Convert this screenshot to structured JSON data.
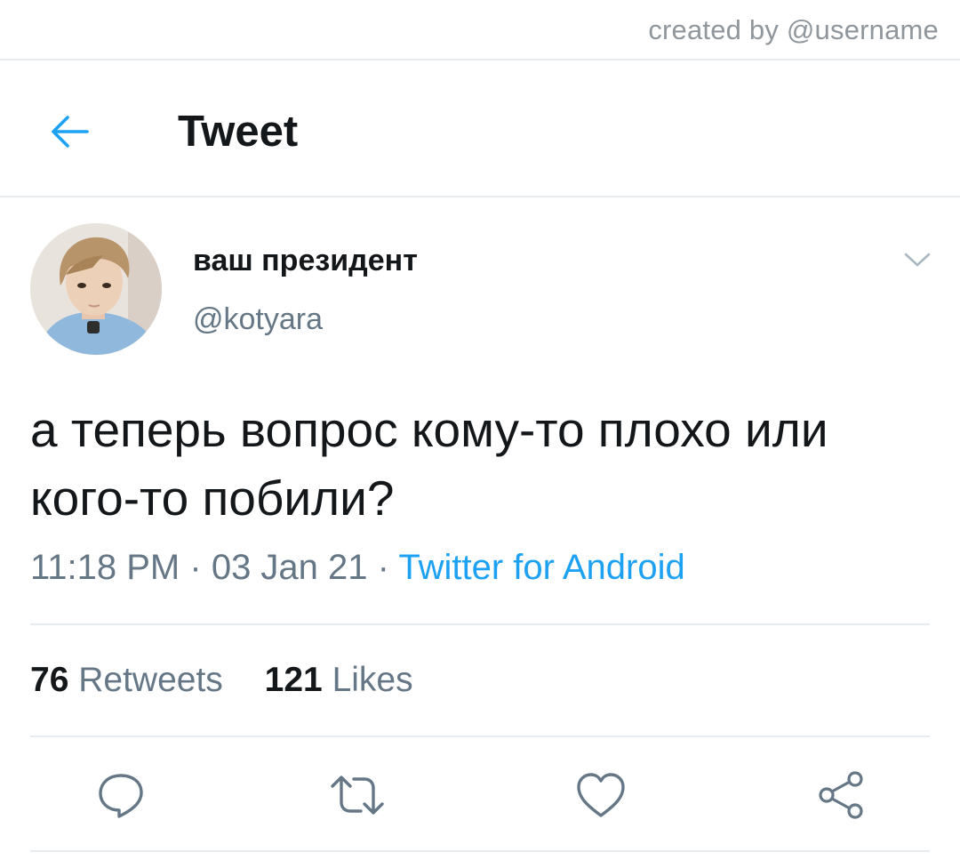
{
  "credit": "created by @username",
  "header": {
    "title": "Tweet"
  },
  "tweet": {
    "author_name": "ваш президент",
    "author_handle": "@kotyara",
    "text": "а теперь вопрос кому-то плохо или кого-то побили?",
    "time": "11:18 PM",
    "date": "03 Jan 21",
    "separator": "·",
    "source": "Twitter for Android"
  },
  "stats": {
    "retweets_count": "76",
    "retweets_label": "Retweets",
    "likes_count": "121",
    "likes_label": "Likes"
  },
  "icons": {
    "back": "arrow-left-icon",
    "caret": "chevron-down-icon",
    "reply": "reply-bubble-icon",
    "retweet": "retweet-icon",
    "like": "heart-icon",
    "share": "share-icon"
  },
  "colors": {
    "accent": "#1da1f2",
    "text": "#14171a",
    "muted": "#657786",
    "divider": "#e6ecf0"
  }
}
